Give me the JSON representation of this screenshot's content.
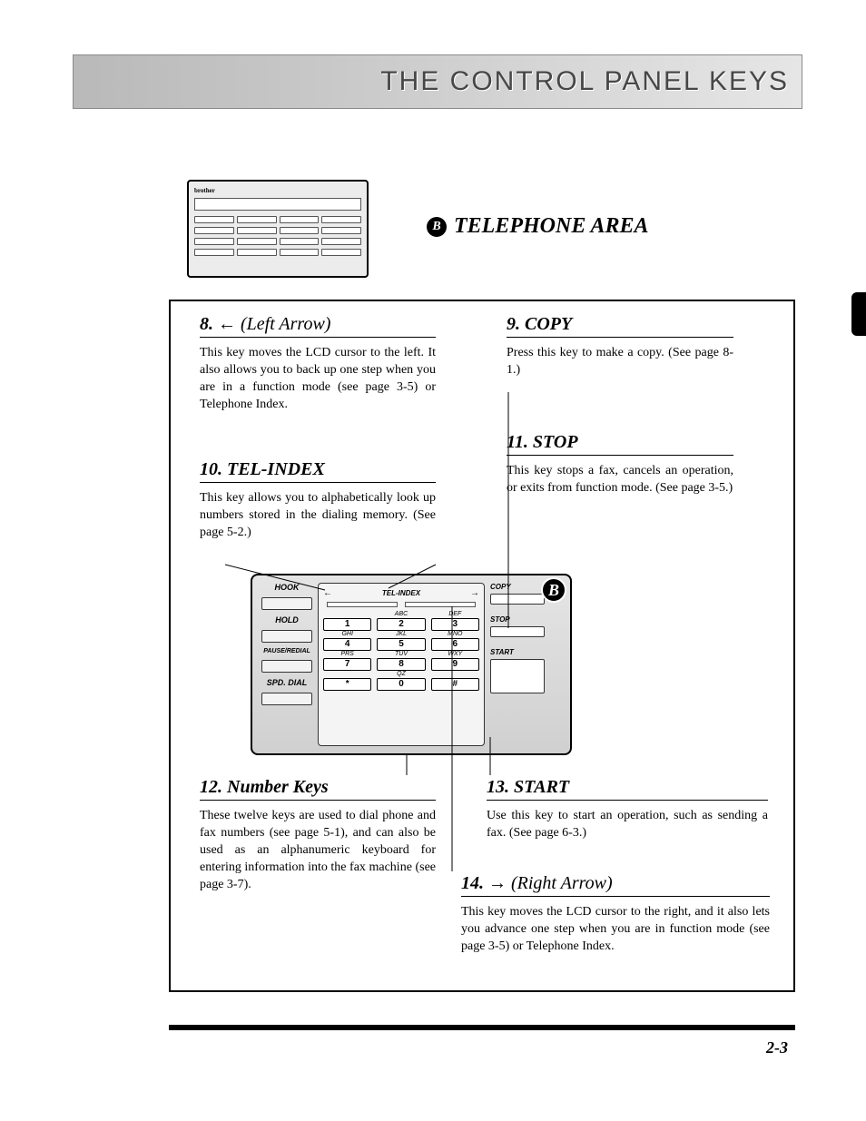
{
  "header": {
    "title": "THE CONTROL PANEL KEYS"
  },
  "badge": "B",
  "area_title": "TELEPHONE AREA",
  "thumb_brand": "brother",
  "sections": {
    "s8": {
      "num": "8.",
      "arrow": "←",
      "paren": "(Left Arrow)",
      "body": "This key moves the LCD cursor to the left. It also allows you to back up one step when you are in a function mode (see page 3-5) or Telephone Index."
    },
    "s9": {
      "num": "9. COPY",
      "body": "Press this key to make a copy. (See page 8-1.)"
    },
    "s10": {
      "num": "10. TEL-INDEX",
      "body": "This key allows you to alphabetically look up numbers stored in the dialing memory. (See page 5-2.)"
    },
    "s11": {
      "num": "11. STOP",
      "body": "This key stops a fax, cancels an operation, or exits from function mode. (See page 3-5.)"
    },
    "s12": {
      "num": "12. Number Keys",
      "body": "These twelve keys are used to dial phone and fax numbers (see page 5-1), and can also be used as an alphanumeric keyboard for entering information into the fax machine (see page 3-7)."
    },
    "s13": {
      "num": "13. START",
      "body": "Use this key to start an operation, such as sending a fax. (See page 6-3.)"
    },
    "s14": {
      "num": "14.",
      "arrow": "→",
      "paren": "(Right Arrow)",
      "body": "This key moves the LCD cursor to the right, and it also lets you advance one step when you are in function mode (see page 3-5) or Telephone Index."
    }
  },
  "device": {
    "left_labels": [
      "HOOK",
      "HOLD",
      "PAUSE/REDIAL",
      "SPD. DIAL"
    ],
    "tel_index": "TEL-INDEX",
    "letters": [
      "",
      "ABC",
      "DEF",
      "GHI",
      "JKL",
      "MNO",
      "PRS",
      "TUV",
      "WXY",
      "",
      "QZ",
      ""
    ],
    "keys": [
      "1",
      "2",
      "3",
      "4",
      "5",
      "6",
      "7",
      "8",
      "9",
      "*",
      "0",
      "#"
    ],
    "right_labels": {
      "copy": "COPY",
      "stop": "STOP",
      "start": "START"
    }
  },
  "page_number": "2-3"
}
